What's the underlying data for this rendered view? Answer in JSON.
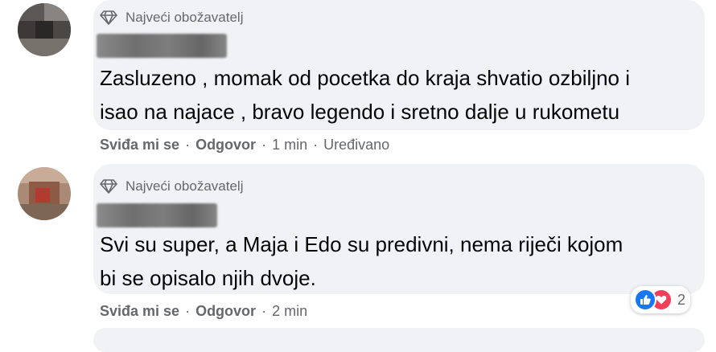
{
  "comments": [
    {
      "badge": "Najveći obožavatelj",
      "text": "Zasluzeno , momak od pocetka do kraja shvatio ozbiljno i\nisao na najace , bravo legendo i sretno dalje u rukometu",
      "like": "Sviđa mi se",
      "reply": "Odgovor",
      "sep": "·",
      "time": "1 min",
      "edited": "Uređivano"
    },
    {
      "badge": "Najveći obožavatelj",
      "text": "Svi su super, a Maja i Edo su predivni, nema riječi kojom\nbi se opisalo njih dvoje.",
      "like": "Sviđa mi se",
      "reply": "Odgovor",
      "sep": "·",
      "time": "2 min",
      "reaction_count": "2"
    }
  ],
  "icons": {
    "badge": "diamond-icon",
    "like_reaction": "thumbs-up-icon",
    "love_reaction": "heart-icon"
  },
  "colors": {
    "bubble": "#f0f2f5",
    "meta_text": "#65676b",
    "like_blue": "#1877f2",
    "love_red": "#f33e58"
  }
}
